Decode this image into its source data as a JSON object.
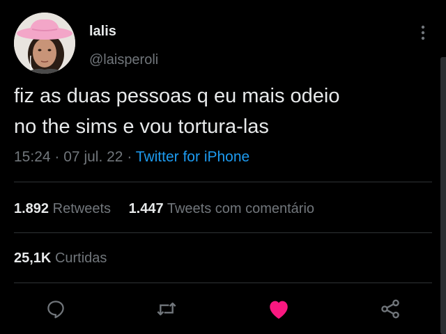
{
  "user": {
    "display_name": "lalis",
    "handle": "@laisperoli"
  },
  "tweet": {
    "text_line_1": "fiz as duas pessoas q eu mais odeio",
    "text_line_2": "no the sims e vou tortura-las",
    "time": "15:24",
    "date": "07 jul. 22",
    "separator": "·",
    "source": "Twitter for iPhone"
  },
  "stats": {
    "retweets_value": "1.892",
    "retweets_label": "Retweets",
    "quotes_value": "1.447",
    "quotes_label": "Tweets com comentário",
    "likes_value": "25,1K",
    "likes_label": "Curtidas"
  },
  "icons": {
    "reply": "reply-icon",
    "retweet": "retweet-icon",
    "like": "heart-icon",
    "share": "share-icon",
    "more": "more-vertical-icon"
  },
  "colors": {
    "background": "#000000",
    "text": "#e7e9ea",
    "muted": "#71767b",
    "link": "#1d9bf0",
    "like": "#f91880",
    "divider": "#2f3336",
    "hat": "#f3a6c8"
  }
}
